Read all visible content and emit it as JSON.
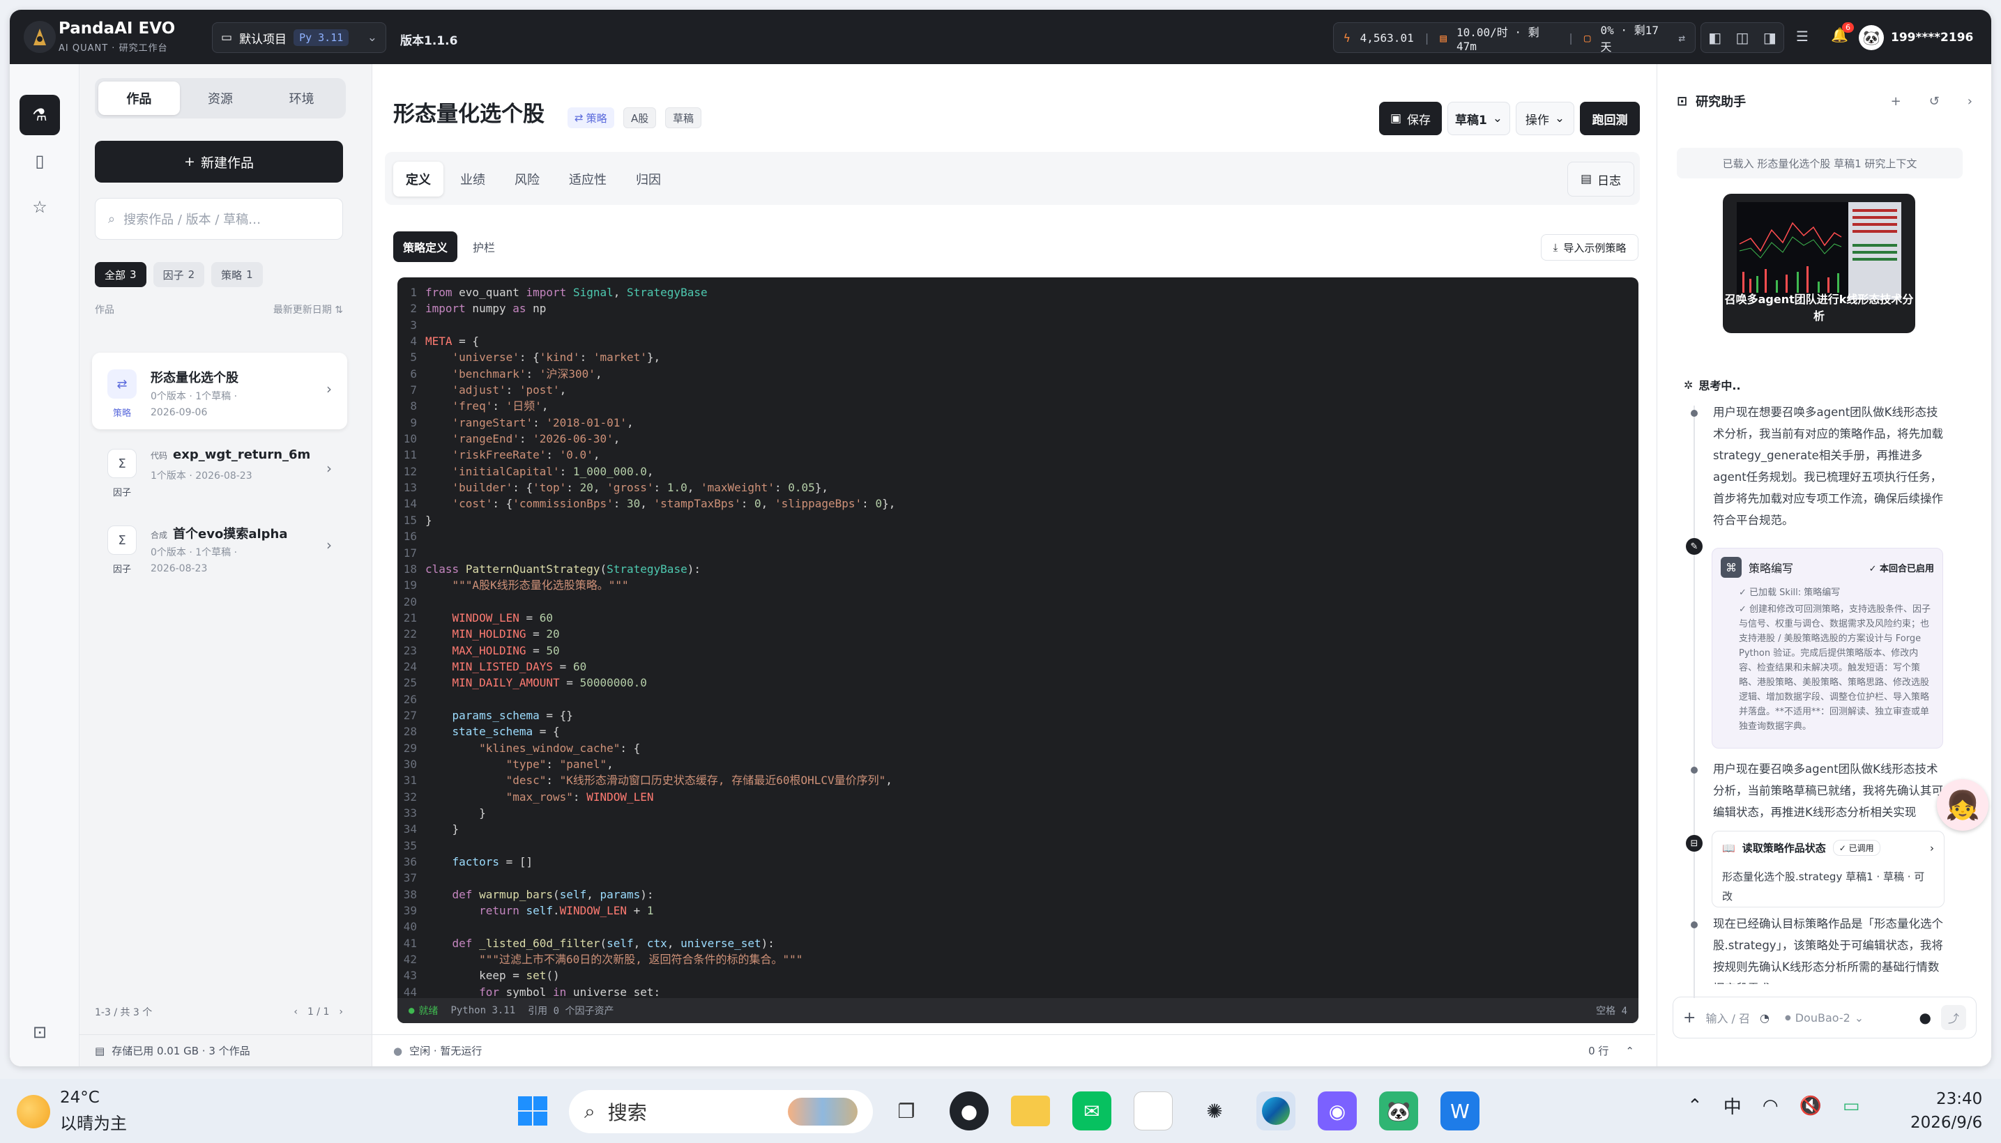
{
  "topbar": {
    "brand": "PandaAI EVO",
    "tagline": "AI QUANT · 研究工作台",
    "project": "默认项目",
    "python": "Py 3.11",
    "version": "版本1.1.6",
    "stat_points": "4,563.01",
    "stat_rate": "10.00/时 · 剩47m",
    "stat_usage": "0% · 剩17天",
    "notif_count": "6",
    "username": "199****2196"
  },
  "sidebar": {
    "tabs": [
      "作品",
      "资源",
      "环境"
    ],
    "new_button": "新建作品",
    "search_placeholder": "搜索作品 / 版本 / 草稿…",
    "chips": [
      {
        "label": "全部",
        "count": "3"
      },
      {
        "label": "因子",
        "count": "2"
      },
      {
        "label": "策略",
        "count": "1"
      }
    ],
    "list_label": "作品",
    "sort_label": "最新更新日期",
    "items": [
      {
        "title": "形态量化选个股",
        "prefix": "",
        "meta": "0个版本 · 1个草稿 ·",
        "date": "2026-09-06",
        "type": "策略",
        "icon": "⇄"
      },
      {
        "title": "exp_wgt_return_6m",
        "prefix": "代码",
        "meta": "1个版本 · 2026-08-23",
        "date": "",
        "type": "因子",
        "icon": "Σ"
      },
      {
        "title": "首个evo摸索alpha",
        "prefix": "合成",
        "meta": "0个版本 · 1个草稿 ·",
        "date": "2026-08-23",
        "type": "因子",
        "icon": "Σ"
      }
    ],
    "pager_text": "1-3 / 共 3 个",
    "page": "1 / 1",
    "storage": "存储已用 0.01 GB · 3 个作品"
  },
  "main": {
    "title": "形态量化选个股",
    "tag_strategy": "策略",
    "tag_market": "A股",
    "tag_status": "草稿",
    "save": "保存",
    "draft": "草稿1",
    "ops": "操作",
    "run": "跑回测",
    "tabs": [
      "定义",
      "业绩",
      "风险",
      "适应性",
      "归因"
    ],
    "log": "日志",
    "editor_tabs": [
      "策略定义",
      "护栏"
    ],
    "import_example": "导入示例策略",
    "status_ready": "就绪",
    "status_python": "Python 3.11",
    "status_refs": "引用 0 个因子资产",
    "status_indent": "空格 4",
    "run_status": "空闲 · 暂无运行",
    "row_count": "0 行"
  },
  "assistant": {
    "title": "研究助手",
    "context": "已载入 形态量化选个股 草稿1 研究上下文",
    "attachment_caption": "召唤多agent团队进行k线形态技术分析",
    "thinking": "思考中..",
    "para1": "用户现在想要召唤多agent团队做K线形态技术分析，我当前有对应的策略作品，将先加载strategy_generate相关手册，再推进多agent任务规划。我已梳理好五项执行任务，首步将先加载对应专项工作流，确保后续操作符合平台规范。",
    "skill_title": "策略编写",
    "skill_enabled": "✓ 本回合已启用",
    "skill_loaded": "✓ 已加载 Skill: 策略编写",
    "skill_desc": "✓ 创建和修改可回测策略，支持选股条件、因子与信号、权重与调仓、数据需求及风险约束；也支持港股 / 美股策略选股的方案设计与 Forge Python 验证。完成后提供策略版本、修改内容、检查结果和未解决项。触发短语：写个策略、港股策略、美股策略、策略思路、修改选股逻辑、增加数据字段、调整仓位护栏、导入策略并落盘。**不适用**：回测解读、独立审查或单独查询数据字典。",
    "para2": "用户现在要召唤多agent团队做K线形态技术分析，当前策略草稿已就绪，我将先确认其可编辑状态，再推进K线形态分析相关实现",
    "tool_title": "读取策略作品状态",
    "tool_called": "✓ 已调用",
    "tool_result": "形态量化选个股.strategy 草稿1 · 草稿 · 可改",
    "para3": "现在已经确认目标策略作品是「形态量化选个股.strategy」，该策略处于可编辑状态，我将按规则先确认K线形态分析所需的基础行情数据字段需求",
    "input_placeholder": "输入 / 召",
    "model": "DouBao-2"
  },
  "taskbar": {
    "temp": "24°C",
    "weather": "以晴为主",
    "search": "搜索",
    "ime": "中",
    "time": "23:40",
    "date": "2026/9/6"
  }
}
